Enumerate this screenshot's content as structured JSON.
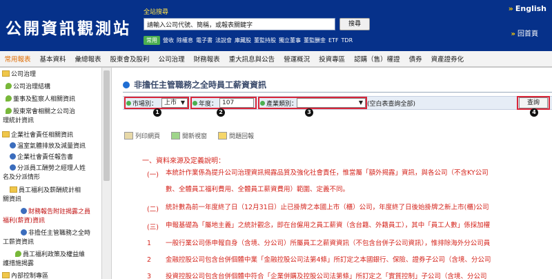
{
  "header": {
    "logo": "公開資訊觀測站",
    "search_label": "全站搜尋",
    "search_placeholder": "請輸入公司代號、簡稱，或報表關鍵字",
    "search_button": "搜尋",
    "quick_badge": "常用",
    "quick_links": [
      "營收",
      "除權息",
      "電子書",
      "法說會",
      "庫藏股",
      "董監持股",
      "獨立董事",
      "董監酬金",
      "ETF",
      "TDR"
    ],
    "english": "English",
    "home": "回首頁"
  },
  "nav": {
    "items": [
      "常用報表",
      "基本資料",
      "彙總報表",
      "股東會及股利",
      "公司治理",
      "財務報表",
      "重大訊息與公告",
      "營運概況",
      "投資專區",
      "認購（售）權證",
      "債券",
      "資產證券化"
    ],
    "active_index": 0
  },
  "sidebar": {
    "items": [
      {
        "label": "公司治理"
      },
      {
        "label": "公司治理結構"
      },
      {
        "label": "董事及監察人相關資訊"
      },
      {
        "label": "股東常會相關之公司治"
      },
      {
        "label": "理統計資訊"
      },
      {
        "label": "企業社會責任相關資訊"
      },
      {
        "label": "溫室氣體排放及減量資訊"
      },
      {
        "label": "企業社會責任報告書"
      },
      {
        "label": "分派員工酬勞之經理人姓"
      },
      {
        "label": "名及分派情形"
      },
      {
        "label": "員工福利及薪酬統計相"
      },
      {
        "label": "關資訊"
      },
      {
        "label": "財務報告附註揭露之員"
      },
      {
        "label": "福利(薪資)資訊"
      },
      {
        "label": "非擔任主管職務之全時"
      },
      {
        "label": "工薪資資訊"
      },
      {
        "label": "員工福利政策及權益維"
      },
      {
        "label": "護措施揭露"
      },
      {
        "label": "內部控制專區"
      }
    ]
  },
  "main": {
    "title": "非擔任主管職務之全時員工薪資資訊",
    "filters": {
      "market_label": "市場別：",
      "market_value": "上市",
      "year_label": "年度：",
      "year_value": "107",
      "industry_label": "產業類別：",
      "industry_value": "",
      "note": "(空白表查詢全部)",
      "query_button": "查詢",
      "markers": [
        "1",
        "2",
        "3",
        "4"
      ]
    },
    "tools": [
      "列印網頁",
      "開新視窗",
      "問題回報"
    ],
    "section_title": "一、資料來源及定義說明：",
    "paragraphs": [
      {
        "num": "(一)",
        "text": "本統計作業係為提升公司治理資訊揭露品質及強化社會責任，惟當屬「額外揭露」資訊，與各公司（不含KY公司"
      },
      {
        "num": "",
        "text": "數、全體員工福利費用、全體員工薪資費用）範圍、定義不同。"
      },
      {
        "num": "(二)",
        "text": "統計數為前一年度終了日（12月31日）止已掛牌之本國上市（櫃）公司，年度終了日後始掛牌之新上市(櫃)公司"
      },
      {
        "num": "(三)",
        "text": "申報基礎為「屬地主義」之統計觀念，即在台僱用之員工薪資（含台籍、外籍員工），其中「員工人數」係採加權"
      },
      {
        "num": "1",
        "text": "一般行業公司係申報自身（含境、分公司）所屬員工之薪資資訊（不包含台併子公司資訊），惟排除海外分公司員"
      },
      {
        "num": "2",
        "text": "金融控股公司包含台併個體中業「金融控股公司法第4條」所訂定之本國銀行、保險、證券子公司（含境、分公司"
      },
      {
        "num": "3",
        "text": "投資控股公司包含台併個體中符合「企業併購及控股公司法第條」所訂定之「實質控制」子公司（含境、分公司"
      }
    ]
  }
}
